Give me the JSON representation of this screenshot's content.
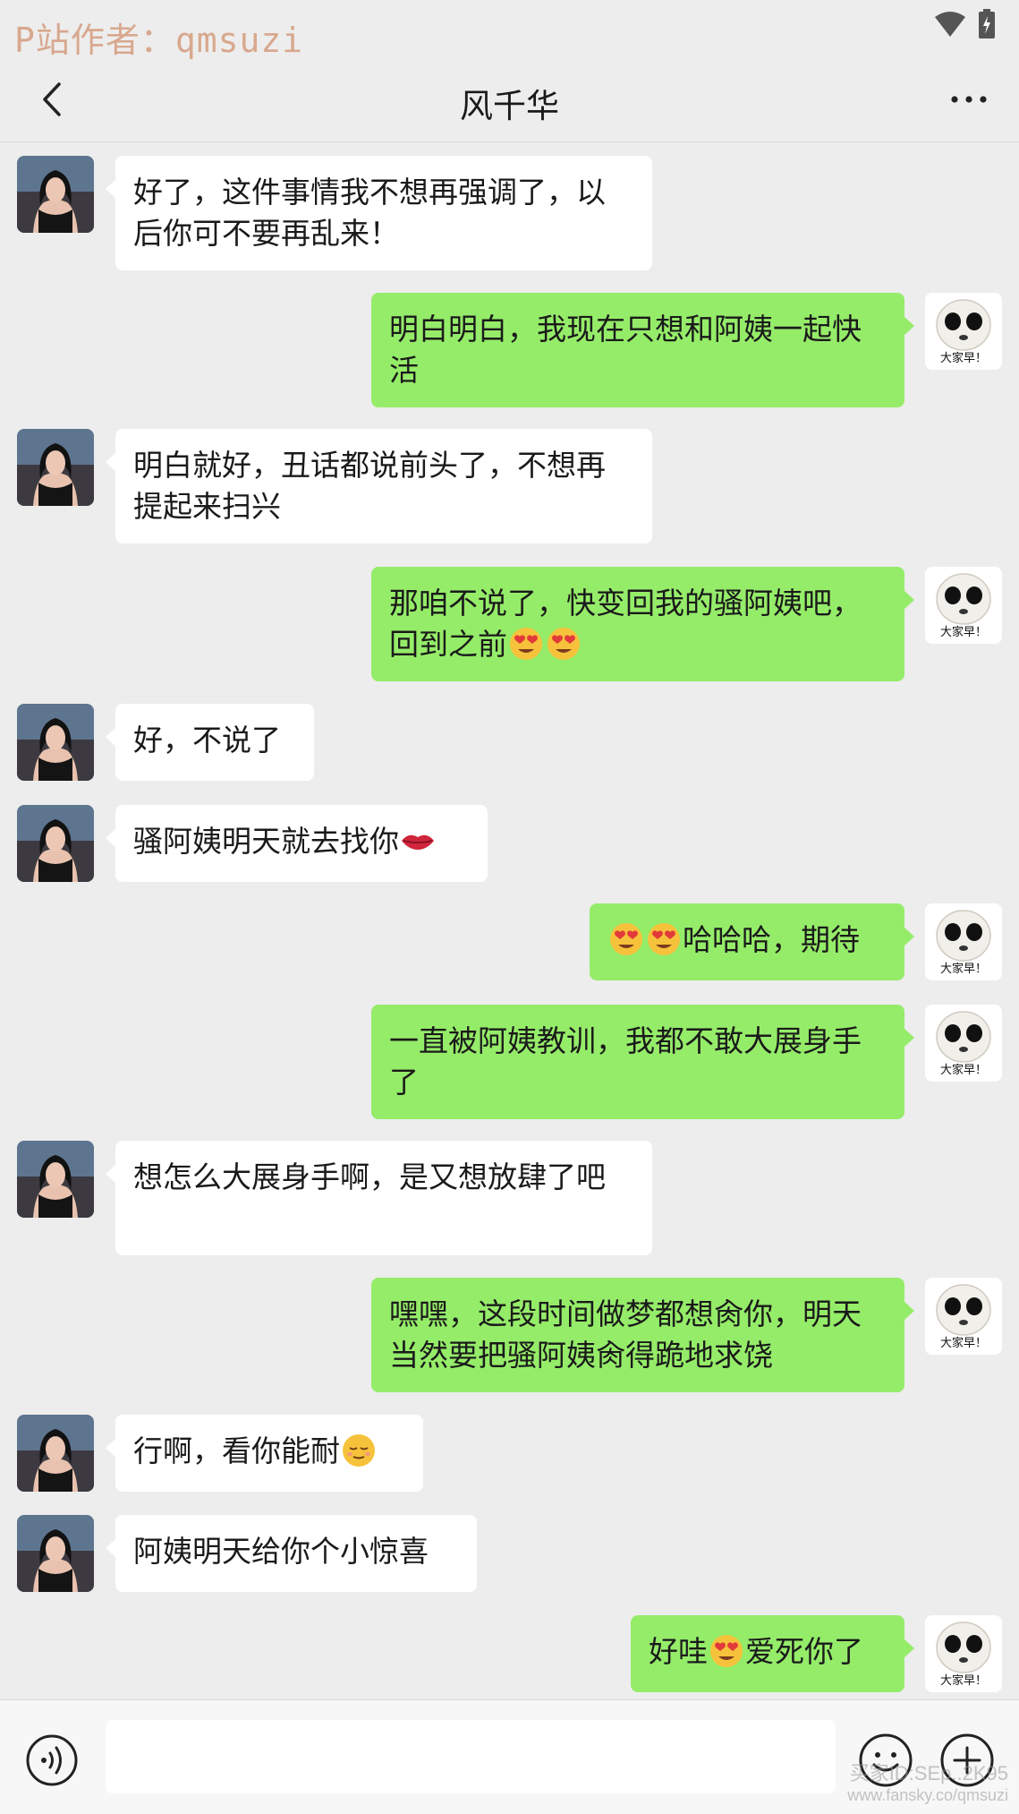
{
  "watermark_top": "P站作者：qmsuzi",
  "header": {
    "title": "风千华"
  },
  "messages": [
    {
      "side": "left",
      "text": "好了，这件事情我不想再强调了，以后你可不要再乱来！"
    },
    {
      "side": "right",
      "text": "明白明白，我现在只想和阿姨一起快活"
    },
    {
      "side": "left",
      "text": "明白就好，丑话都说前头了，不想再提起来扫兴"
    },
    {
      "side": "right",
      "text": "那咱不说了，快变回我的骚阿姨吧，回到之前",
      "emojis": [
        "heart-eyes",
        "heart-eyes"
      ]
    },
    {
      "side": "left",
      "text": "好，不说了"
    },
    {
      "side": "left",
      "text": "骚阿姨明天就去找你",
      "emojis": [
        "lips"
      ]
    },
    {
      "side": "right",
      "text": "哈哈哈，期待",
      "emojis_before": [
        "heart-eyes",
        "heart-eyes"
      ]
    },
    {
      "side": "right",
      "text": "一直被阿姨教训，我都不敢大展身手了"
    },
    {
      "side": "left",
      "text": "想怎么大展身手啊，是又想放肆了吧"
    },
    {
      "side": "right",
      "text": "嘿嘿，这段时间做梦都想肏你，明天当然要把骚阿姨肏得跪地求饶"
    },
    {
      "side": "left",
      "text": "行啊，看你能耐",
      "emojis": [
        "smug-face"
      ]
    },
    {
      "side": "left",
      "text": "阿姨明天给你个小惊喜"
    },
    {
      "side": "right",
      "text_before": "好哇",
      "text_after": "爱死你了",
      "emojis": [
        "heart-eyes"
      ]
    }
  ],
  "sticker_caption": "大家早！",
  "input": {
    "placeholder": ""
  },
  "watermark_bottom": {
    "line1": "买家ID:SEp..2K95",
    "line2": "www.fansky.co/qmsuzi"
  },
  "colors": {
    "background": "#ededed",
    "bubble_left": "#ffffff",
    "bubble_right": "#95ec69"
  },
  "icons": {
    "back": "chevron-left-icon",
    "more": "more-icon",
    "voice": "voice-icon",
    "emoji": "emoji-icon",
    "plus": "plus-icon",
    "wifi": "wifi-icon",
    "battery": "battery-icon"
  }
}
